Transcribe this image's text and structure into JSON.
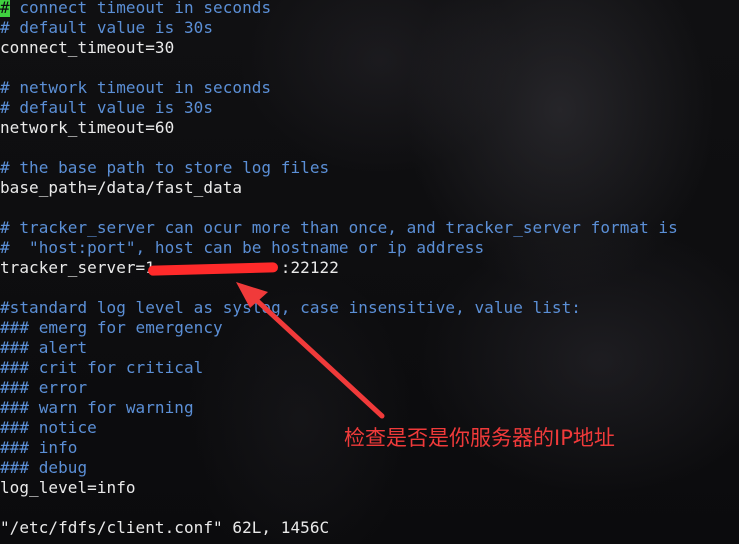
{
  "terminal": {
    "lines": [
      {
        "type": "comment",
        "cursor": "#",
        "text": " connect timeout in seconds"
      },
      {
        "type": "comment",
        "text": "# default value is 30s"
      },
      {
        "type": "plain",
        "text": "connect_timeout=30"
      },
      {
        "type": "blank",
        "text": ""
      },
      {
        "type": "comment",
        "text": "# network timeout in seconds"
      },
      {
        "type": "comment",
        "text": "# default value is 30s"
      },
      {
        "type": "plain",
        "text": "network_timeout=60"
      },
      {
        "type": "blank",
        "text": ""
      },
      {
        "type": "comment",
        "text": "# the base path to store log files"
      },
      {
        "type": "plain",
        "text": "base_path=/data/fast_data"
      },
      {
        "type": "blank",
        "text": ""
      },
      {
        "type": "comment",
        "text": "# tracker_server can ocur more than once, and tracker_server format is"
      },
      {
        "type": "comment",
        "text": "#  \"host:port\", host can be hostname or ip address"
      },
      {
        "type": "plain",
        "text": "tracker_server=1             :22122"
      },
      {
        "type": "blank",
        "text": ""
      },
      {
        "type": "comment",
        "text": "#standard log level as syslog, case insensitive, value list:"
      },
      {
        "type": "comment",
        "text": "### emerg for emergency"
      },
      {
        "type": "comment",
        "text": "### alert"
      },
      {
        "type": "comment",
        "text": "### crit for critical"
      },
      {
        "type": "comment",
        "text": "### error"
      },
      {
        "type": "comment",
        "text": "### warn for warning"
      },
      {
        "type": "comment",
        "text": "### notice"
      },
      {
        "type": "comment",
        "text": "### info"
      },
      {
        "type": "comment",
        "text": "### debug"
      },
      {
        "type": "plain",
        "text": "log_level=info"
      },
      {
        "type": "blank",
        "text": ""
      },
      {
        "type": "plain",
        "text": "\"/etc/fdfs/client.conf\" 62L, 1456C"
      }
    ]
  },
  "annotation": {
    "text": "检查是否是你服务器的IP地址",
    "color": "#f03a3a"
  },
  "colors": {
    "comment": "#5b8fd6",
    "plain": "#eaeaea",
    "cursor": "#3fd13f",
    "background": "#0d0d0f"
  }
}
